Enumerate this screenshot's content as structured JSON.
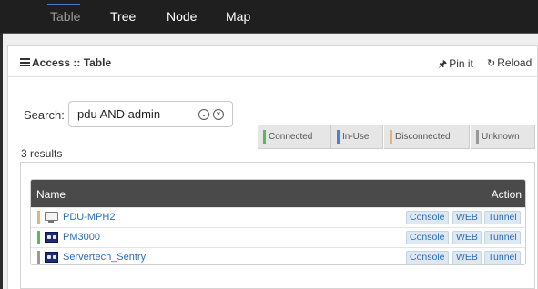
{
  "nav": {
    "tabs": [
      {
        "label": "Table",
        "active": true
      },
      {
        "label": "Tree",
        "active": false
      },
      {
        "label": "Node",
        "active": false
      },
      {
        "label": "Map",
        "active": false
      }
    ]
  },
  "panel": {
    "title": "Access :: Table",
    "pin_label": "Pin it",
    "reload_label": "Reload"
  },
  "search": {
    "label": "Search:",
    "value": "pdu AND admin"
  },
  "results_text": "3 results",
  "legend": [
    {
      "label": "Connected",
      "color": "#5cb85c"
    },
    {
      "label": "In-Use",
      "color": "#4a7fd4"
    },
    {
      "label": "Disconnected",
      "color": "#e8b07a"
    },
    {
      "label": "Unknown",
      "color": "#999999"
    }
  ],
  "table": {
    "columns": {
      "name": "Name",
      "action": "Action"
    },
    "rows": [
      {
        "name": "PDU-MPH2",
        "status_color": "#e8b07a",
        "icon": "monitor-icon",
        "actions": [
          "Console",
          "WEB",
          "Tunnel"
        ]
      },
      {
        "name": "PM3000",
        "status_color": "#5cb85c",
        "icon": "pdu-device-icon",
        "actions": [
          "Console",
          "WEB",
          "Tunnel"
        ]
      },
      {
        "name": "Servertech_Sentry",
        "status_color": "#999999",
        "icon": "pdu-device-icon",
        "actions": [
          "Console",
          "WEB",
          "Tunnel"
        ]
      }
    ]
  }
}
